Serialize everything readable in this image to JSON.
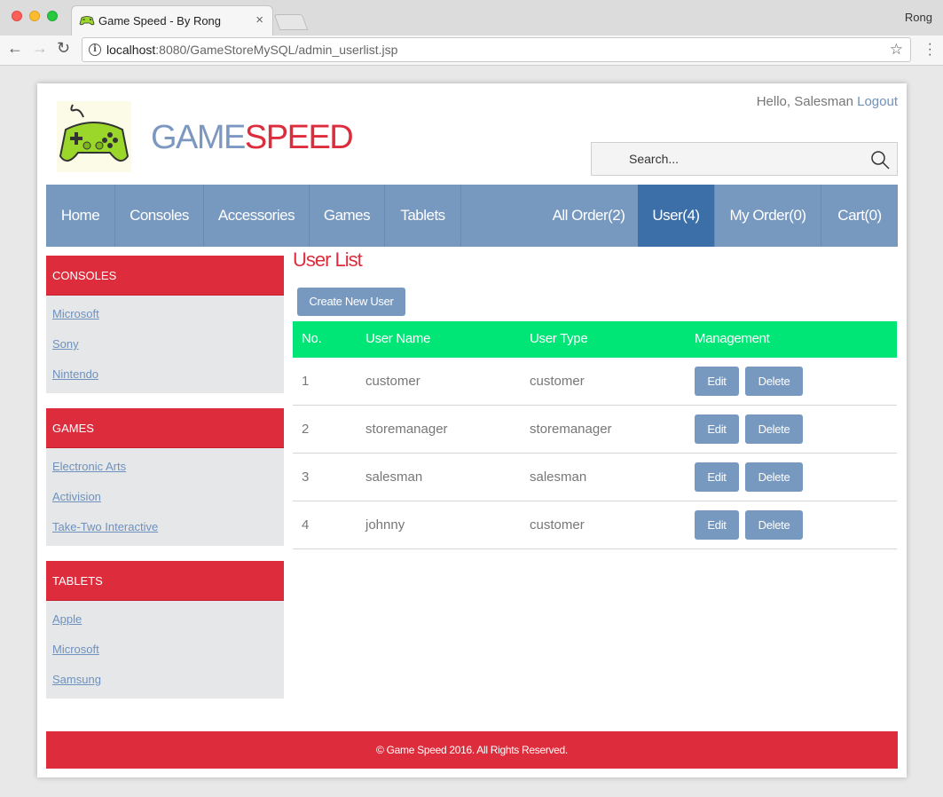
{
  "browser": {
    "tab_title": "Game Speed - By Rong",
    "profile": "Rong",
    "url_host": "localhost",
    "url_rest": ":8080/GameStoreMySQL/admin_userlist.jsp"
  },
  "header": {
    "greeting": "Hello, Salesman",
    "logout": "Logout",
    "brand_first": "GAME",
    "brand_second": "SPEED",
    "search_placeholder": "Search..."
  },
  "nav": {
    "left": [
      "Home",
      "Consoles",
      "Accessories",
      "Games",
      "Tablets"
    ],
    "right": [
      "All Order(2)",
      "User(4)",
      "My Order(0)",
      "Cart(0)"
    ],
    "active": "User(4)"
  },
  "sidebar": [
    {
      "title": "CONSOLES",
      "links": [
        "Microsoft",
        "Sony",
        "Nintendo"
      ]
    },
    {
      "title": "GAMES",
      "links": [
        "Electronic Arts",
        "Activision",
        "Take-Two Interactive"
      ]
    },
    {
      "title": "TABLETS",
      "links": [
        "Apple",
        "Microsoft",
        "Samsung"
      ]
    }
  ],
  "main": {
    "title": "User List",
    "create_button": "Create New User",
    "columns": [
      "No.",
      "User Name",
      "User Type",
      "Management"
    ],
    "rows": [
      {
        "no": "1",
        "name": "customer",
        "type": "customer"
      },
      {
        "no": "2",
        "name": "storemanager",
        "type": "storemanager"
      },
      {
        "no": "3",
        "name": "salesman",
        "type": "salesman"
      },
      {
        "no": "4",
        "name": "johnny",
        "type": "customer"
      }
    ],
    "edit_label": "Edit",
    "delete_label": "Delete"
  },
  "footer": {
    "text": "© Game Speed 2016. All Rights Reserved."
  },
  "colors": {
    "brand_red": "#dd2c3b",
    "brand_blue": "#7798bf",
    "active_blue": "#3c6ea8",
    "table_header_green": "#00e676"
  }
}
